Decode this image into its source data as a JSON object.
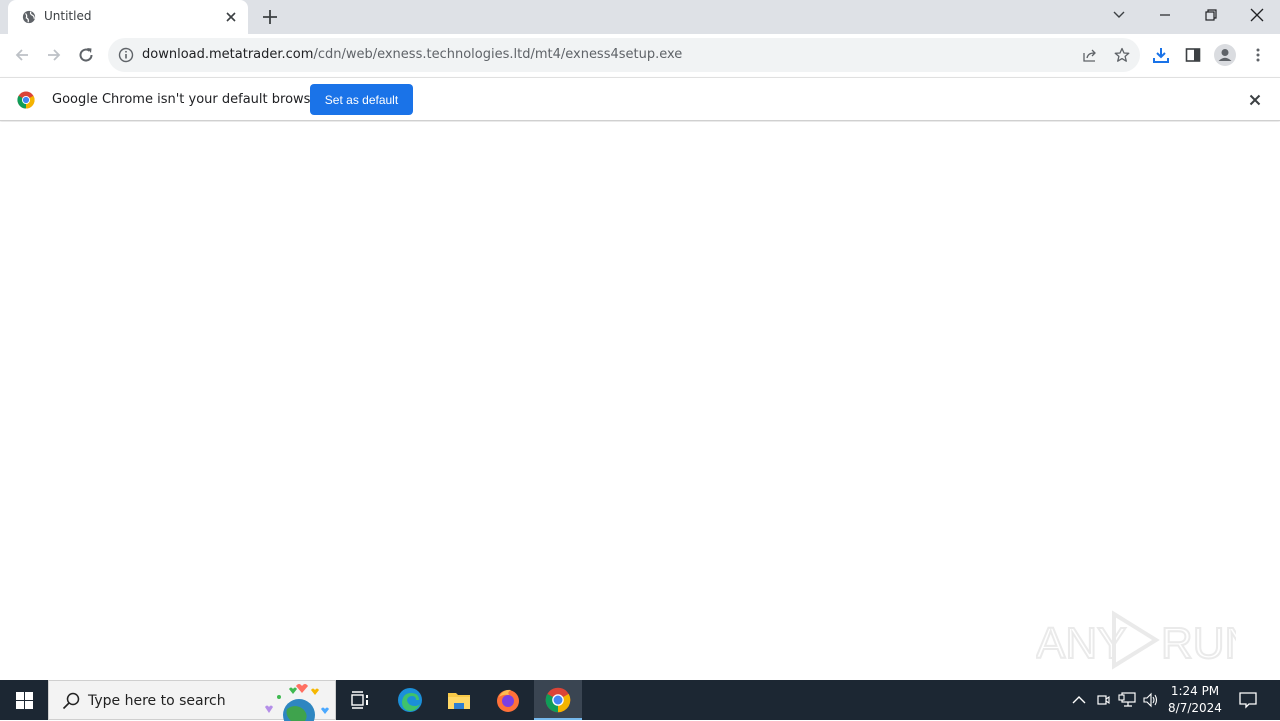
{
  "browser": {
    "tab": {
      "title": "Untitled",
      "favicon": "globe-icon"
    },
    "window_controls": [
      "tab-search",
      "minimize",
      "restore",
      "close"
    ],
    "omnibox": {
      "host": "download.metatrader.com",
      "path": "/cdn/web/exness.technologies.ltd/mt4/exness4setup.exe",
      "security_icon": "info-icon"
    },
    "toolbar_icons": [
      "share-icon",
      "bookmark-star-icon",
      "download-icon",
      "side-panel-icon",
      "profile-icon",
      "menu-icon"
    ],
    "accent_color": "#1a73e8"
  },
  "infobar": {
    "message": "Google Chrome isn't your default browser",
    "button_label": "Set as default"
  },
  "watermark": {
    "text": "ANY RUN"
  },
  "taskbar": {
    "search_placeholder": "Type here to search",
    "apps": [
      "Task View",
      "Microsoft Edge",
      "File Explorer",
      "Firefox",
      "Google Chrome"
    ],
    "clock": {
      "time": "1:24 PM",
      "date": "8/7/2024"
    }
  }
}
